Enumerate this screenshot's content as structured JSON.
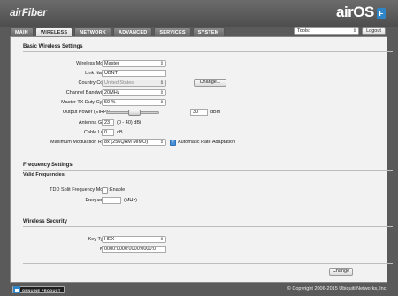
{
  "header": {
    "brand": "airFiber",
    "os_name": "airOS",
    "os_badge": "F"
  },
  "tabs": [
    {
      "label": "MAIN"
    },
    {
      "label": "WIRELESS"
    },
    {
      "label": "NETWORK"
    },
    {
      "label": "ADVANCED"
    },
    {
      "label": "SERVICES"
    },
    {
      "label": "SYSTEM"
    }
  ],
  "tools": {
    "selected": "Tools:",
    "logout_label": "Logout"
  },
  "basic": {
    "title": "Basic Wireless Settings",
    "wireless_mode": {
      "label": "Wireless Mode:",
      "value": "Master"
    },
    "link_name": {
      "label": "Link Name:",
      "value": "UBNT"
    },
    "country_code": {
      "label": "Country Code:",
      "value": "United States",
      "change_label": "Change..."
    },
    "channel_bandwidth": {
      "label": "Channel Bandwidth:",
      "value": "20MHz"
    },
    "master_tx": {
      "label": "Master TX Duty Cycle:",
      "value": "50 %"
    },
    "output_power": {
      "label": "Output Power (EIRP):",
      "value": "30",
      "unit": "dBm",
      "slider_fraction": 0.55
    },
    "antenna_gain": {
      "label": "Antenna Gain:",
      "value": "23",
      "note": "(0 - 40) dBi"
    },
    "cable_loss": {
      "label": "Cable Loss:",
      "value": "0",
      "unit": "dB"
    },
    "max_mod": {
      "label": "Maximum Modulation Rate:",
      "value": "8x (256QAM MIMO)",
      "auto_label": "Automatic Rate Adaptation",
      "auto_checked": true
    }
  },
  "frequency": {
    "title": "Frequency Settings",
    "valid_label": "Valid Frequencies:",
    "tdd_label": "TDD Split Frequency Mode:",
    "tdd_enable_label": "Enable",
    "tdd_checked": false,
    "frequency_label": "Frequency:",
    "frequency_value": "",
    "frequency_unit": "(MHz)"
  },
  "security": {
    "title": "Wireless Security",
    "key_type": {
      "label": "Key Type:",
      "value": "HEX"
    },
    "key": {
      "label": "Key:",
      "value": "0000:0000:0000:0000:0"
    }
  },
  "actions": {
    "change_label": "Change"
  },
  "footer": {
    "badge_text": "GENUINE PRODUCT",
    "copyright": "© Copyright 2006-2015 Ubiquiti Networks, Inc."
  },
  "colors": {
    "accent": "#2e86c8",
    "header_bg": "#5a5a5a",
    "panel_bg": "#f2f2f2"
  }
}
